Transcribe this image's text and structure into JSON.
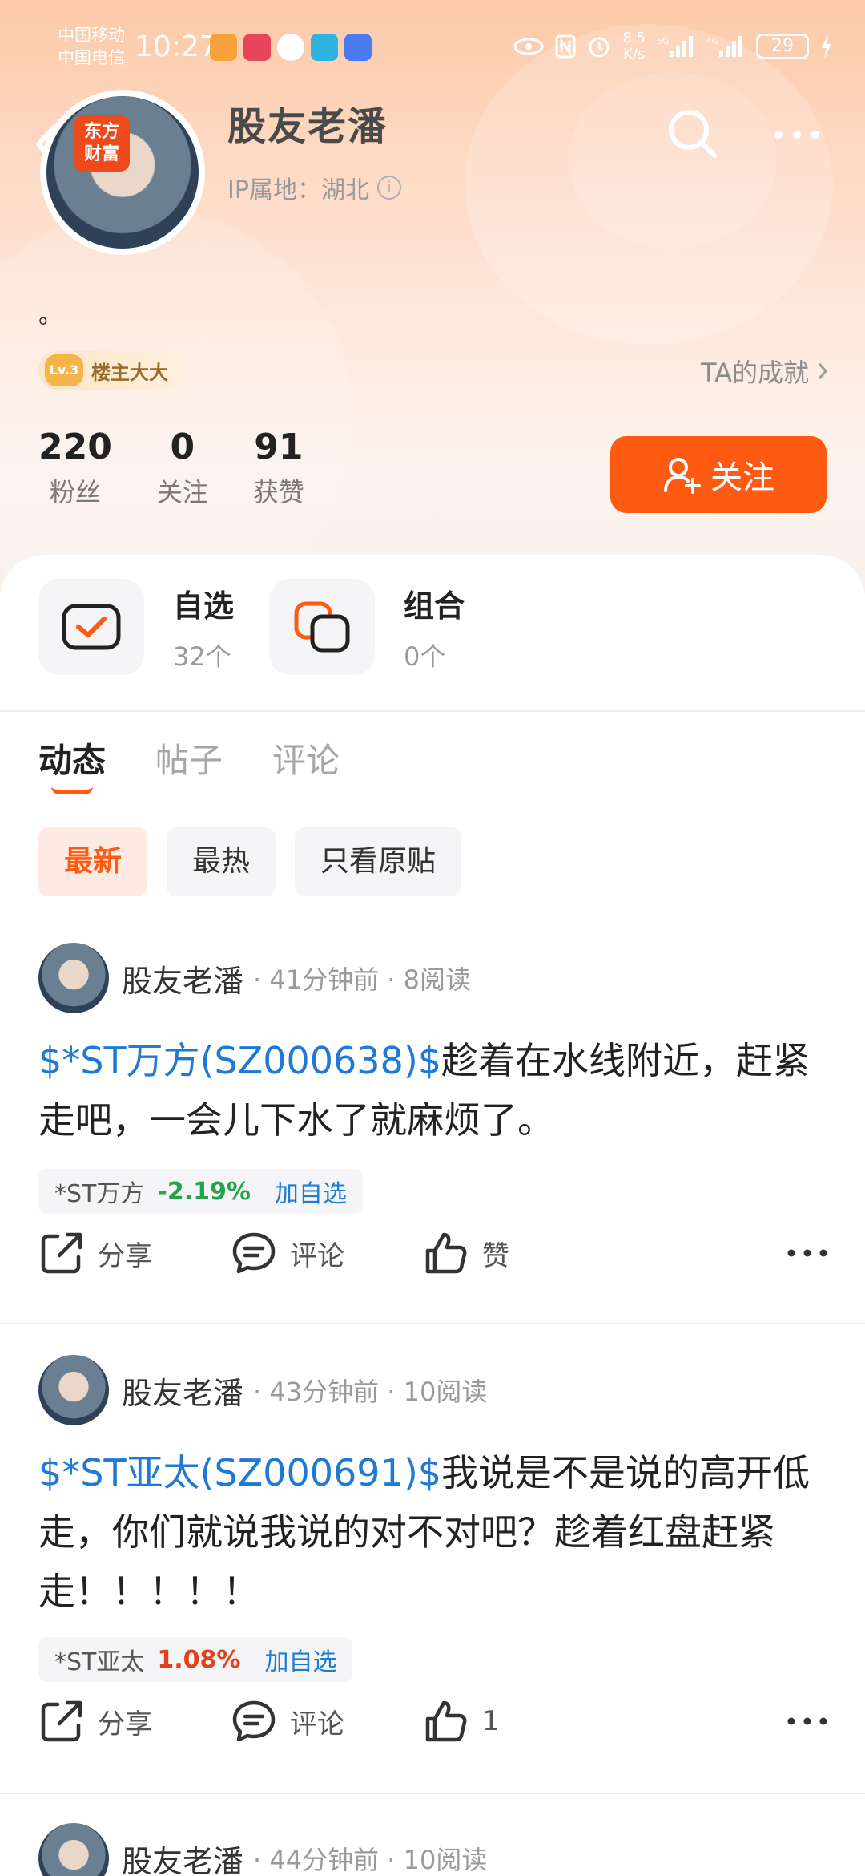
{
  "status": {
    "carrier1": "中国移动",
    "carrier2": "中国电信",
    "time": "10:27",
    "net_speed": "8.5",
    "net_unit": "K/s",
    "battery": "29"
  },
  "profile": {
    "avatar_logo_line1": "东方",
    "avatar_logo_line2": "财富",
    "name": "股友老潘",
    "ip_label": "IP属地：湖北",
    "bio": "。",
    "level_icon": "Lv.3",
    "level_title": "楼主大大",
    "achievements": "TA的成就",
    "stats": [
      {
        "value": "220",
        "label": "粉丝"
      },
      {
        "value": "0",
        "label": "关注"
      },
      {
        "value": "91",
        "label": "获赞"
      }
    ],
    "follow_label": "关注"
  },
  "quick_links": [
    {
      "title": "自选",
      "sub": "32个"
    },
    {
      "title": "组合",
      "sub": "0个"
    }
  ],
  "tabs": [
    "动态",
    "帖子",
    "评论"
  ],
  "filters": [
    "最新",
    "最热",
    "只看原贴"
  ],
  "posts": [
    {
      "author": "股友老潘",
      "meta": "· 41分钟前 · 8阅读",
      "stock_tag": "$*ST万方(SZ000638)$",
      "text": "趁着在水线附近，赶紧走吧，一会儿下水了就麻烦了。",
      "chip_name": "*ST万方",
      "chip_change": "-2.19%",
      "chip_action": "加自选",
      "share": "分享",
      "comment": "评论",
      "like": "赞"
    },
    {
      "author": "股友老潘",
      "meta": "· 43分钟前 · 10阅读",
      "stock_tag": "$*ST亚太(SZ000691)$",
      "text": "我说是不是说的高开低走，你们就说我说的对不对吧？趁着红盘赶紧走！！！！！",
      "chip_name": "*ST亚太",
      "chip_change": "1.08%",
      "chip_action": "加自选",
      "share": "分享",
      "comment": "评论",
      "like": "1"
    },
    {
      "author": "股友老潘",
      "meta": "· 44分钟前 · 10阅读"
    }
  ],
  "colors": {
    "accent": "#fe5a12",
    "link": "#1e7ad4",
    "down": "#27a24a",
    "up": "#e2421b"
  }
}
